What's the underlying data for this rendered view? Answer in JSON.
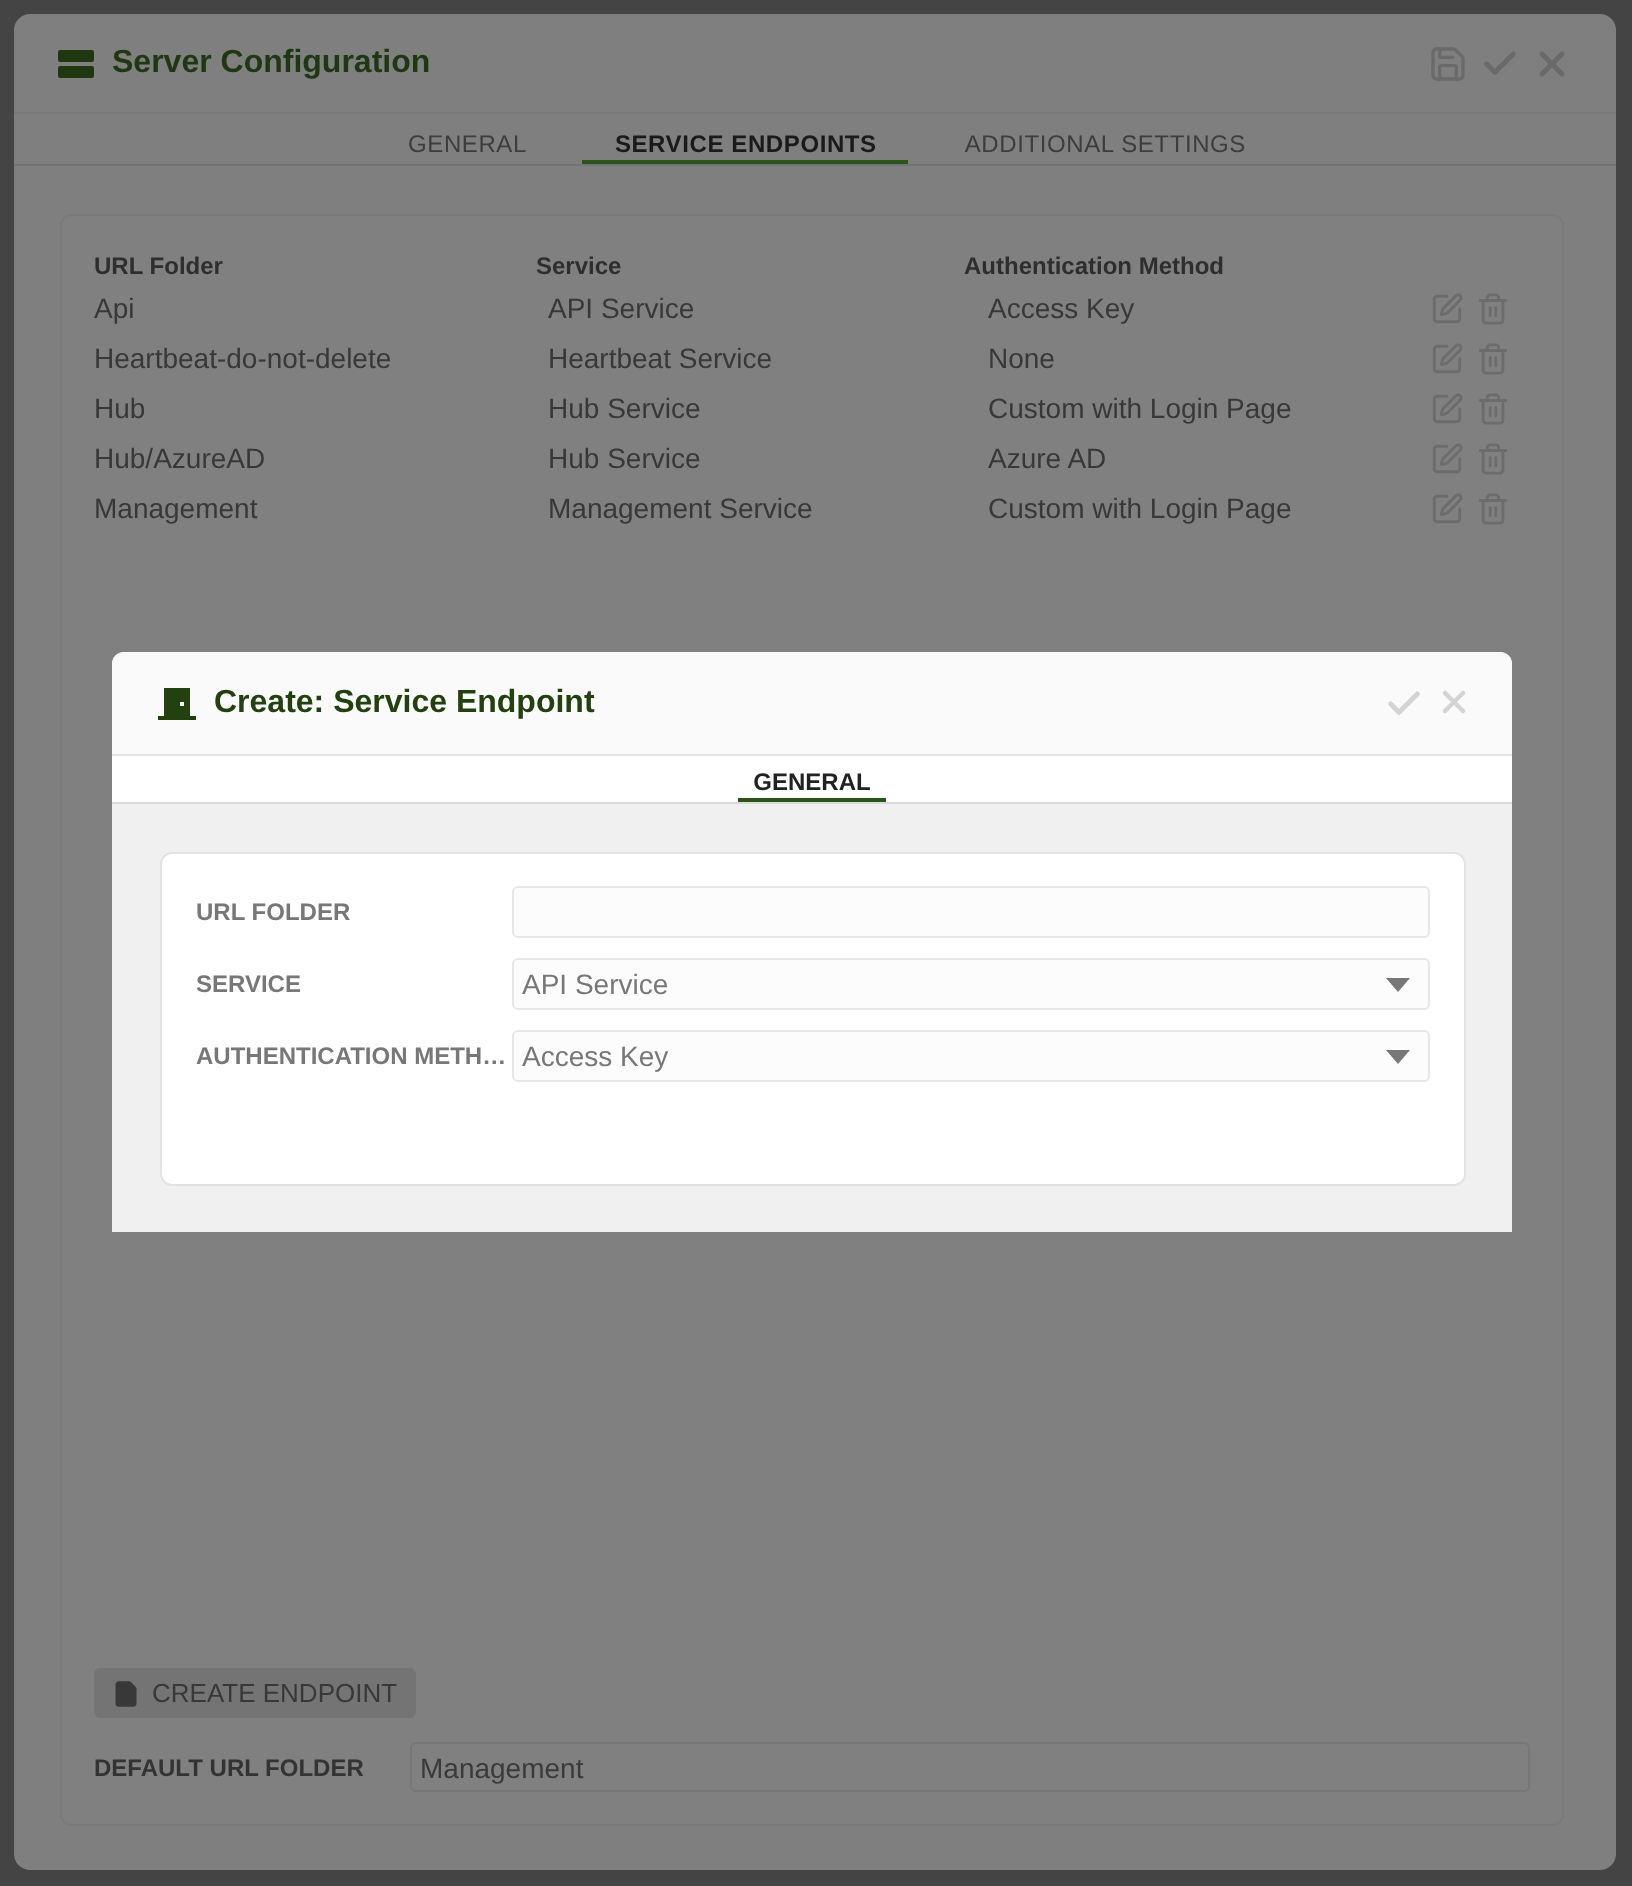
{
  "window": {
    "title": "Server Configuration"
  },
  "tabs": [
    {
      "label": "GENERAL",
      "selected": false
    },
    {
      "label": "SERVICE ENDPOINTS",
      "selected": true
    },
    {
      "label": "ADDITIONAL SETTINGS",
      "selected": false
    }
  ],
  "table": {
    "columns": [
      "URL Folder",
      "Service",
      "Authentication Method"
    ],
    "rows": [
      {
        "url_folder": "Api",
        "service": "API Service",
        "authentication_method": "Access Key"
      },
      {
        "url_folder": "Heartbeat-do-not-delete",
        "service": "Heartbeat Service",
        "authentication_method": "None"
      },
      {
        "url_folder": "Hub",
        "service": "Hub Service",
        "authentication_method": "Custom with Login Page"
      },
      {
        "url_folder": "Hub/AzureAD",
        "service": "Hub Service",
        "authentication_method": "Azure AD"
      },
      {
        "url_folder": "Management",
        "service": "Management Service",
        "authentication_method": "Custom with Login Page"
      }
    ]
  },
  "create_button": "CREATE ENDPOINT",
  "default_url_folder": {
    "label": "DEFAULT URL FOLDER",
    "value": "Management"
  },
  "dialog": {
    "title": "Create: Service Endpoint",
    "tabs": [
      {
        "label": "GENERAL",
        "selected": true
      }
    ],
    "fields": [
      {
        "label": "URL FOLDER",
        "kind": "text"
      },
      {
        "label": "SERVICE",
        "kind": "select",
        "value": "API Service"
      },
      {
        "label": "AUTHENTICATION METH…",
        "kind": "select",
        "value": "Access Key"
      }
    ]
  }
}
